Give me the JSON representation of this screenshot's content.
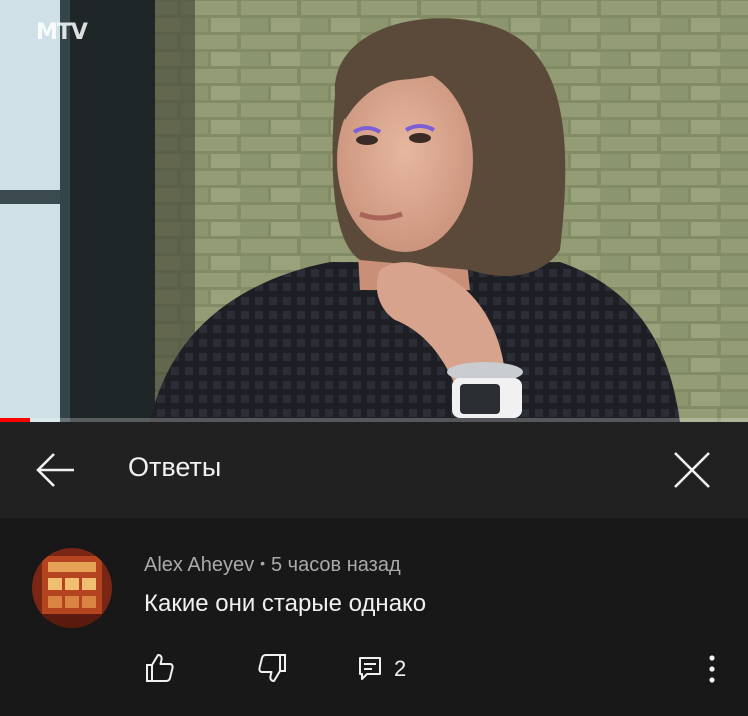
{
  "video": {
    "channel_logo": "MTV",
    "progress": 0.04,
    "progress_color": "#ff0000"
  },
  "header": {
    "title": "Ответы",
    "back_icon": "arrow-left-icon",
    "close_icon": "close-icon"
  },
  "comment": {
    "author": "Alex Aheyev",
    "separator": "•",
    "time": "5 часов назад",
    "text": "Какие они старые однако",
    "reply_count": "2",
    "icons": {
      "like": "thumb-up-icon",
      "dislike": "thumb-down-icon",
      "reply": "reply-icon",
      "more": "more-vertical-icon"
    }
  },
  "colors": {
    "header_bg": "#212121",
    "page_bg": "#181818",
    "primary_text": "#f1f1f1",
    "secondary_text": "#aaaaaa"
  }
}
